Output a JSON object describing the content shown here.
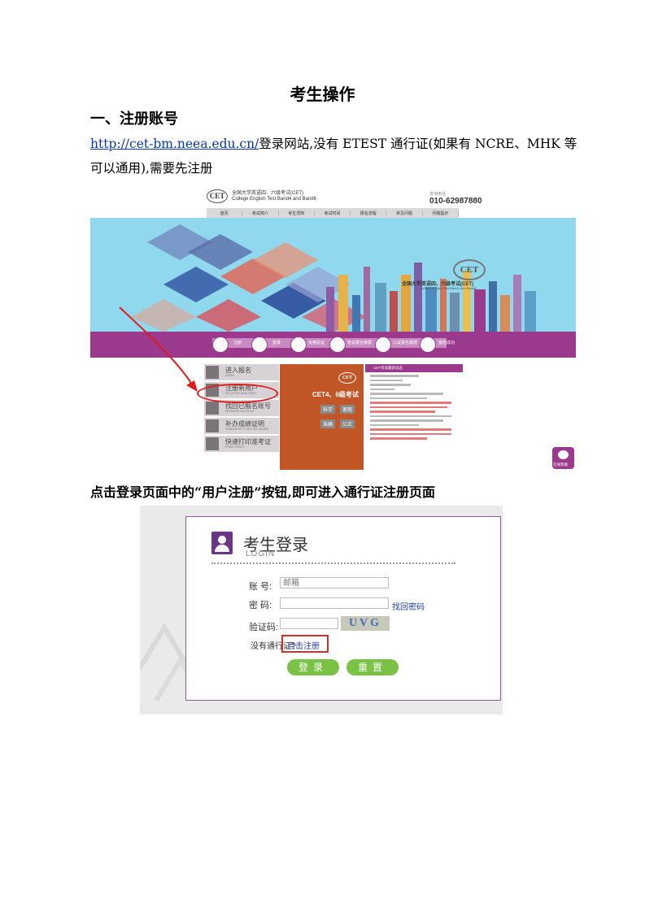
{
  "doc": {
    "title": "考生操作",
    "heading": "一、注册账号",
    "link": "http://cet-bm.neea.edu.cn/",
    "para_rest": "登录网站,没有 ETEST 通行证(如果有 NCRE、MHK 等可以通用),需要先注册",
    "caption": "点击登录页面中的“用户注册”按钮,即可进入通行证注册页面"
  },
  "cet_site": {
    "logo": "CET",
    "site_name": "全国大学英语四、六级考试(CET)",
    "site_name_en": "College English Test Band4 and Band6",
    "hotline_label": "咨询电话",
    "phone": "010-62987880",
    "nav": [
      "首页",
      "考试简介",
      "考生须知",
      "考试时间",
      "报名流程",
      "常见问题",
      "问题提示"
    ],
    "banner_name": "全国大学英语四、六级考试(CET)",
    "banner_name_en": "College English Test Band4 and Band6",
    "steps": [
      "注册",
      "登录",
      "资格验证",
      "笔试报名缴费",
      "口试报名缴费",
      "报名成功"
    ],
    "menu": [
      {
        "label": "进入报名",
        "sub": "ENTRY"
      },
      {
        "label": "注册新用户",
        "sub": "REGISTER NEW USER"
      },
      {
        "label": "找回已报名账号",
        "sub": "RETRIEVE ACCOUNT"
      },
      {
        "label": "补办成绩证明",
        "sub": "TRANSCRIPT COPY RE-ORDER"
      },
      {
        "label": "快速打印准考证",
        "sub": "PRINT TICKET"
      }
    ],
    "promo_title": "CET4、6级考试",
    "promo_chips": [
      "科学",
      "客观",
      "准确",
      "公正"
    ],
    "news_head": "CET考试最新动态",
    "service_label": "在线客服"
  },
  "login": {
    "title": "考生登录",
    "subtitle": "LOGIN",
    "account_label": "账  号:",
    "account_placeholder": "邮箱",
    "password_label": "密  码:",
    "captcha_label": "验证码:",
    "captcha_text": "UVG",
    "retrieve": "找回密码",
    "no_account": "没有通行证?",
    "register": "点击注册",
    "login_btn": "登录",
    "reset_btn": "重置"
  }
}
